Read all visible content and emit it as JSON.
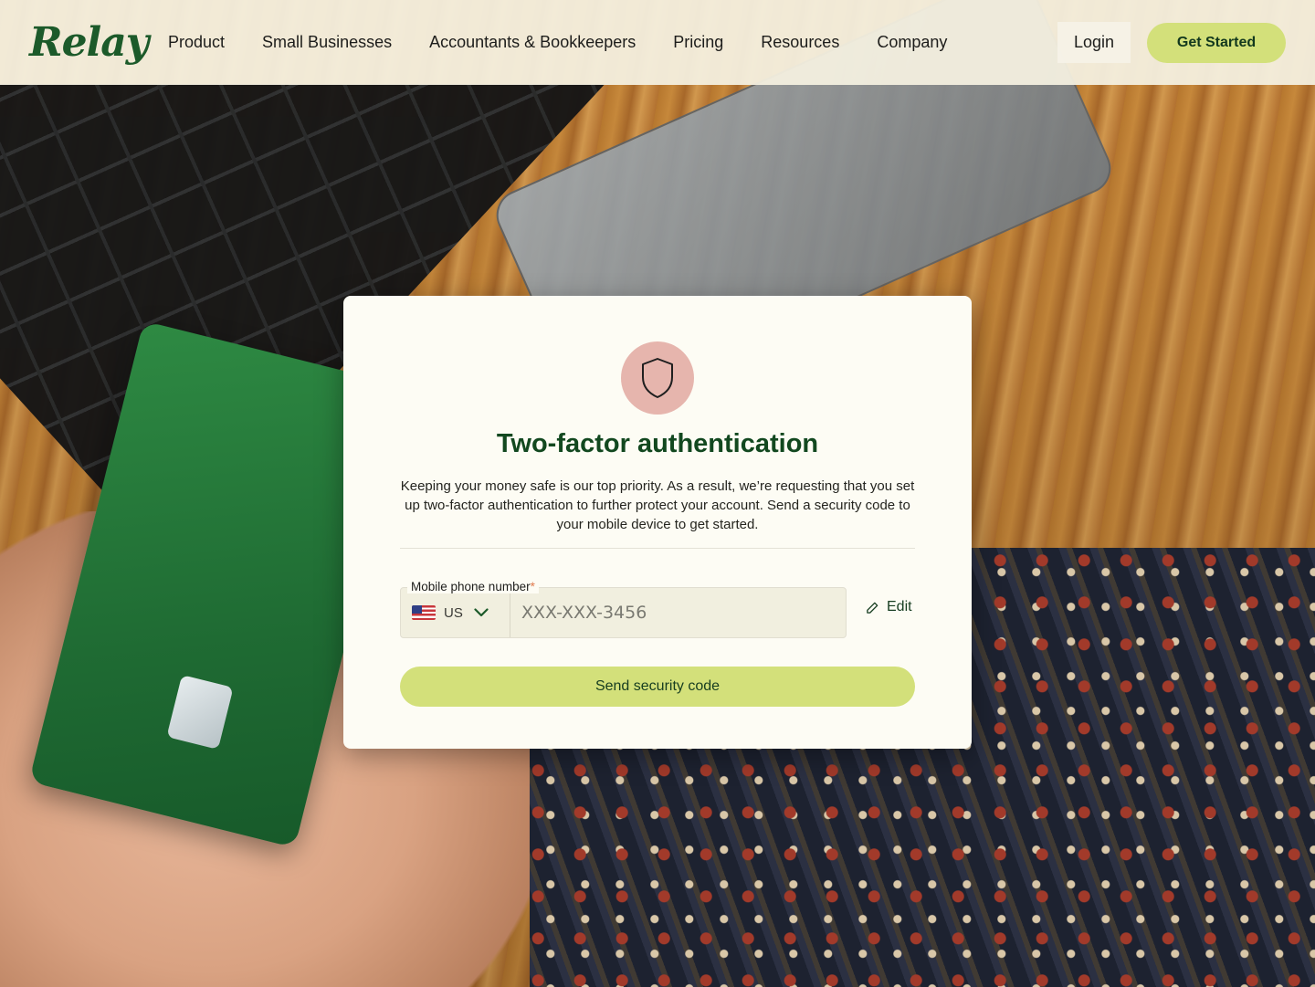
{
  "nav": {
    "logo": "Relay",
    "links": [
      "Product",
      "Small Businesses",
      "Accountants & Bookkeepers",
      "Pricing",
      "Resources",
      "Company"
    ],
    "login": "Login",
    "get_started": "Get Started"
  },
  "auth": {
    "icon": "shield-icon",
    "title": "Two-factor authentication",
    "description": "Keeping your money safe is our top priority. As a result, we’re requesting that you set up two-factor authentication to further protect your account. Send a security code to your mobile device to get started.",
    "phone_label": "Mobile phone number",
    "required_mark": "*",
    "country_code": "US",
    "phone_value": "XXX-XXX-3456",
    "edit_label": "Edit",
    "send_button": "Send security code"
  },
  "colors": {
    "brand_green": "#12481f",
    "accent_lime": "#d3e07a",
    "card_bg": "#fdfcf4",
    "shield_bg": "#e6b5ad"
  }
}
